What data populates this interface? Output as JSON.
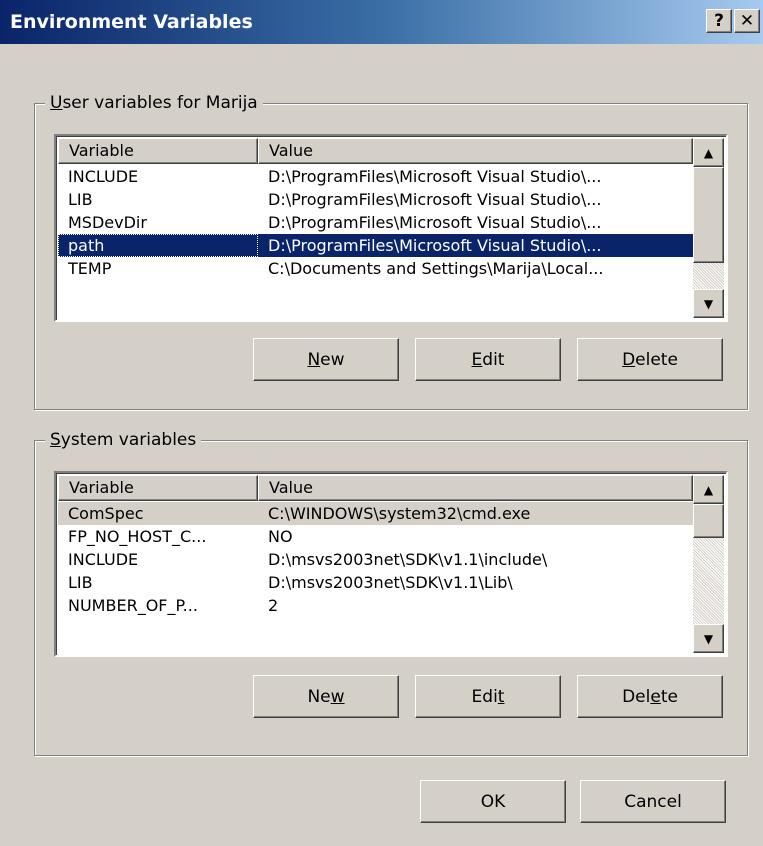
{
  "window": {
    "title": "Environment Variables",
    "help_glyph": "?",
    "close_glyph": "✕"
  },
  "user_group": {
    "label_pre": "",
    "label_mnemonic": "U",
    "label_post": "ser variables for Marija",
    "columns": [
      "Variable",
      "Value"
    ],
    "rows": [
      {
        "variable": "INCLUDE",
        "value": "D:\\ProgramFiles\\Microsoft Visual Studio\\..."
      },
      {
        "variable": "LIB",
        "value": "D:\\ProgramFiles\\Microsoft Visual Studio\\..."
      },
      {
        "variable": "MSDevDir",
        "value": "D:\\ProgramFiles\\Microsoft Visual Studio\\..."
      },
      {
        "variable": "path",
        "value": "D:\\ProgramFiles\\Microsoft Visual Studio\\..."
      },
      {
        "variable": "TEMP",
        "value": "C:\\Documents and Settings\\Marija\\Local..."
      }
    ],
    "selected_row": "path",
    "buttons": {
      "new": {
        "pre": "",
        "mn": "N",
        "post": "ew"
      },
      "edit": {
        "pre": "",
        "mn": "E",
        "post": "dit"
      },
      "delete": {
        "pre": "",
        "mn": "D",
        "post": "elete"
      }
    }
  },
  "system_group": {
    "label_pre": "",
    "label_mnemonic": "S",
    "label_post": "ystem variables",
    "columns": [
      "Variable",
      "Value"
    ],
    "rows": [
      {
        "variable": "ComSpec",
        "value": "C:\\WINDOWS\\system32\\cmd.exe"
      },
      {
        "variable": "FP_NO_HOST_C...",
        "value": "NO"
      },
      {
        "variable": "INCLUDE",
        "value": "D:\\msvs2003net\\SDK\\v1.1\\include\\"
      },
      {
        "variable": "LIB",
        "value": "D:\\msvs2003net\\SDK\\v1.1\\Lib\\"
      },
      {
        "variable": "NUMBER_OF_P...",
        "value": "2"
      }
    ],
    "selected_row": "ComSpec",
    "buttons": {
      "new": {
        "pre": "Ne",
        "mn": "w",
        "post": ""
      },
      "edit": {
        "pre": "Edi",
        "mn": "t",
        "post": ""
      },
      "delete": {
        "pre": "Del",
        "mn": "e",
        "post": "te"
      }
    }
  },
  "dialog_buttons": {
    "ok": "OK",
    "cancel": "Cancel"
  },
  "scrollbar": {
    "up_glyph": "▲",
    "down_glyph": "▼"
  }
}
